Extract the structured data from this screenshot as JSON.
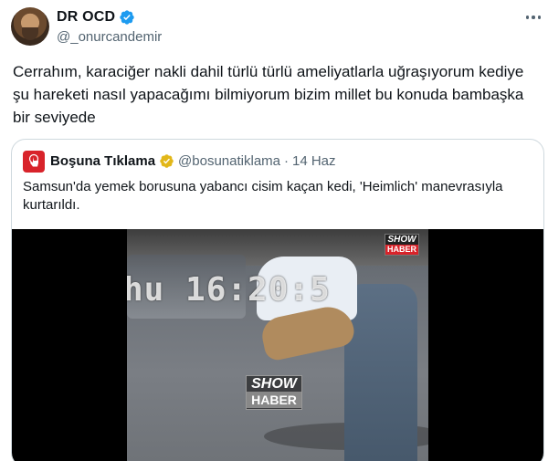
{
  "author": {
    "display_name": "DR OCD",
    "handle": "@_onurcandemir",
    "verified": true
  },
  "tweet": {
    "text": "Cerrahım, karaciğer nakli dahil türlü türlü ameliyatlarla uğraşıyorum kediye şu hareketi nasıl yapacağımı bilmiyorum bizim millet bu konuda bambaşka bir seviyede"
  },
  "quote": {
    "display_name": "Boşuna Tıklama",
    "handle": "@bosunatiklama",
    "separator": "·",
    "date": "14 Haz",
    "text": "Samsun'da yemek borusuna yabancı cisim kaçan kedi, 'Heimlich' manevrasıyla kurtarıldı.",
    "media": {
      "overlay_timestamp": "hu 16:20:5",
      "watermark_top": {
        "line1": "SHOW",
        "line2": "HABER"
      },
      "watermark_center": {
        "line1": "SHOW",
        "line2": "HABER"
      }
    }
  },
  "colors": {
    "verified_blue": "#1d9bf0",
    "gold_badge": "#e2b719",
    "text_secondary": "#536471",
    "border": "#cfd9de",
    "brand_red": "#d8232a"
  },
  "icons": {
    "verified": "verified-badge-icon",
    "more": "more-icon",
    "quote_avatar": "cursor-hand-icon",
    "quote_badge": "gold-verified-badge-icon"
  }
}
